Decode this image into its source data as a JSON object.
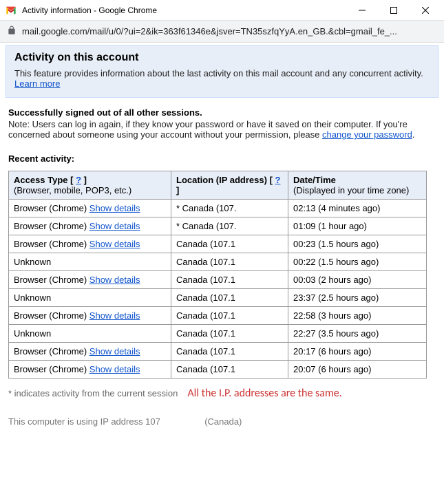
{
  "window": {
    "title": "Activity information - Google Chrome"
  },
  "address": {
    "url": "mail.google.com/mail/u/0/?ui=2&ik=363f61346e&jsver=TN35szfqYyA.en_GB.&cbl=gmail_fe_..."
  },
  "header": {
    "title": "Activity on this account",
    "description": "This feature provides information about the last activity on this mail account and any concurrent activity.",
    "learn_more": "Learn more"
  },
  "signout": {
    "title": "Successfully signed out of all other sessions.",
    "note_prefix": "Note: Users can log in again, if they know your password or have it saved on their computer. If you're concerned about someone using your account without your permission, please ",
    "link": "change your password",
    "note_suffix": "."
  },
  "recent": {
    "title": "Recent activity:",
    "headers": {
      "access": "Access Type",
      "access_sub": "(Browser, mobile, POP3, etc.)",
      "location": "Location (IP address)",
      "datetime": "Date/Time",
      "datetime_sub": "(Displayed in your time zone)"
    },
    "help_symbol": "?",
    "show_details": "Show details",
    "rows": [
      {
        "access": "Browser (Chrome)",
        "detailsLink": true,
        "location": "* Canada (107.",
        "datetime": "02:13 (4 minutes ago)"
      },
      {
        "access": "Browser (Chrome)",
        "detailsLink": true,
        "location": "* Canada (107.",
        "datetime": "01:09 (1 hour ago)"
      },
      {
        "access": "Browser (Chrome)",
        "detailsLink": true,
        "location": "Canada (107.1",
        "datetime": "00:23 (1.5 hours ago)"
      },
      {
        "access": "Unknown",
        "detailsLink": false,
        "location": "Canada (107.1",
        "datetime": "00:22 (1.5 hours ago)"
      },
      {
        "access": "Browser (Chrome)",
        "detailsLink": true,
        "location": "Canada (107.1",
        "datetime": "00:03 (2 hours ago)"
      },
      {
        "access": "Unknown",
        "detailsLink": false,
        "location": "Canada (107.1",
        "datetime": "23:37 (2.5 hours ago)"
      },
      {
        "access": "Browser (Chrome)",
        "detailsLink": true,
        "location": "Canada (107.1",
        "datetime": "22:58 (3 hours ago)"
      },
      {
        "access": "Unknown",
        "detailsLink": false,
        "location": "Canada (107.1",
        "datetime": "22:27 (3.5 hours ago)"
      },
      {
        "access": "Browser (Chrome)",
        "detailsLink": true,
        "location": "Canada (107.1",
        "datetime": "20:17 (6 hours ago)"
      },
      {
        "access": "Browser (Chrome)",
        "detailsLink": true,
        "location": "Canada (107.1",
        "datetime": "20:07 (6 hours ago)"
      }
    ]
  },
  "footnote": "* indicates activity from the current session",
  "annotation": "All the I.P. addresses are the same.",
  "ip_line_prefix": "This computer is using IP address 107",
  "ip_line_suffix": "(Canada)"
}
